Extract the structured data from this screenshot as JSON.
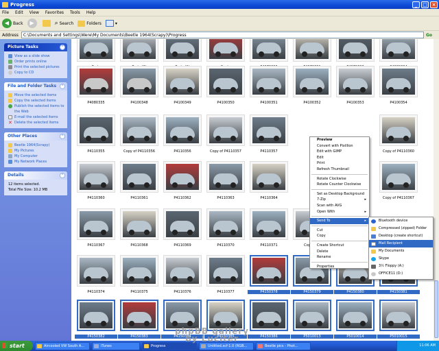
{
  "window": {
    "title": "Progress"
  },
  "menu": [
    "File",
    "Edit",
    "View",
    "Favorites",
    "Tools",
    "Help"
  ],
  "toolbar": {
    "back": "Back",
    "search": "Search",
    "folders": "Folders"
  },
  "address": {
    "label": "Address",
    "path": "C:\\Documents and Settings\\Were\\My Documents\\Beetle 1964(Scrapy)\\Progress",
    "go": "Go"
  },
  "sidebar": {
    "picture_tasks": {
      "title": "Picture Tasks",
      "items": [
        "View as a slide show",
        "Order prints online",
        "Print the selected pictures",
        "Copy to CD"
      ]
    },
    "file_tasks": {
      "title": "File and Folder Tasks",
      "items": [
        "Move the selected items",
        "Copy the selected items",
        "Publish the selected items to the Web",
        "E-mail the selected items",
        "Delete the selected items"
      ]
    },
    "other_places": {
      "title": "Other Places",
      "items": [
        "Beetle 1964(Scrapy)",
        "My Pictures",
        "My Computer",
        "My Network Places"
      ]
    },
    "details": {
      "title": "Details",
      "line1": "12 items selected.",
      "line2": "Total File Size: 10.2 MB"
    }
  },
  "captions": [
    [
      "Parts",
      "Parts (2)",
      "Parts (1)",
      "Seats",
      "P4070330",
      "P4070331",
      "P4070333",
      "P4080334"
    ],
    [
      "P4080335",
      "P4100348",
      "P4100349",
      "P4100350",
      "P4100351",
      "P4100352",
      "P4100353",
      "P4100354"
    ],
    [
      "P4110355",
      "Copy of P4110356",
      "P4110356",
      "Copy of P4110357",
      "P4110357",
      "",
      "",
      "Copy of P4110360"
    ],
    [
      "P4110360",
      "P4110361",
      "P4110362",
      "P4110363",
      "P4110364",
      "",
      "",
      "Copy of P4110367"
    ],
    [
      "P4110367",
      "P4110368",
      "P4110369",
      "P4110370",
      "P4110371",
      "Copy of P",
      "",
      ""
    ],
    [
      "P4110374",
      "P4110375",
      "P4110376",
      "P4110377",
      "P4150378",
      "P4150379",
      "P4150380",
      "P4150381"
    ],
    [
      "P4150382",
      "P4150383",
      "P4150384",
      "P4150385",
      "P4150386",
      "P5010013",
      "P5010014",
      "P5010015"
    ]
  ],
  "context_menu": [
    "Preview",
    "Convert with Pixillion",
    "Edit with GIMP",
    "Edit",
    "Print",
    "Refresh Thumbnail",
    "Rotate Clockwise",
    "Rotate Counter Clockwise",
    "Set as Desktop Background",
    "7-Zip",
    "Scan with AVG",
    "Open With",
    "Send To",
    "Cut",
    "Copy",
    "Create Shortcut",
    "Delete",
    "Rename",
    "Properties"
  ],
  "send_to": [
    "Bluetooth device",
    "Compressed (zipped) Folder",
    "Desktop (create shortcut)",
    "Mail Recipient",
    "My Documents",
    "Skype",
    "3½ Floppy (A:)",
    "OFFICE11 (D:)"
  ],
  "taskbar": {
    "start": "start",
    "buttons": [
      "Aircooled VW South A...",
      "iTunes",
      "Progress",
      "Untitled.xcf-1.0 (RGB...",
      "Beetle pics - Phot..."
    ],
    "clock": "11:06 AM"
  },
  "watermark": {
    "line1": "phpBB gallery",
    "line2": "by Luciter"
  },
  "colors": {
    "selection": "#316ac5",
    "titlebar": "#0d4ad6",
    "sidebar": "#6f8ee0"
  }
}
